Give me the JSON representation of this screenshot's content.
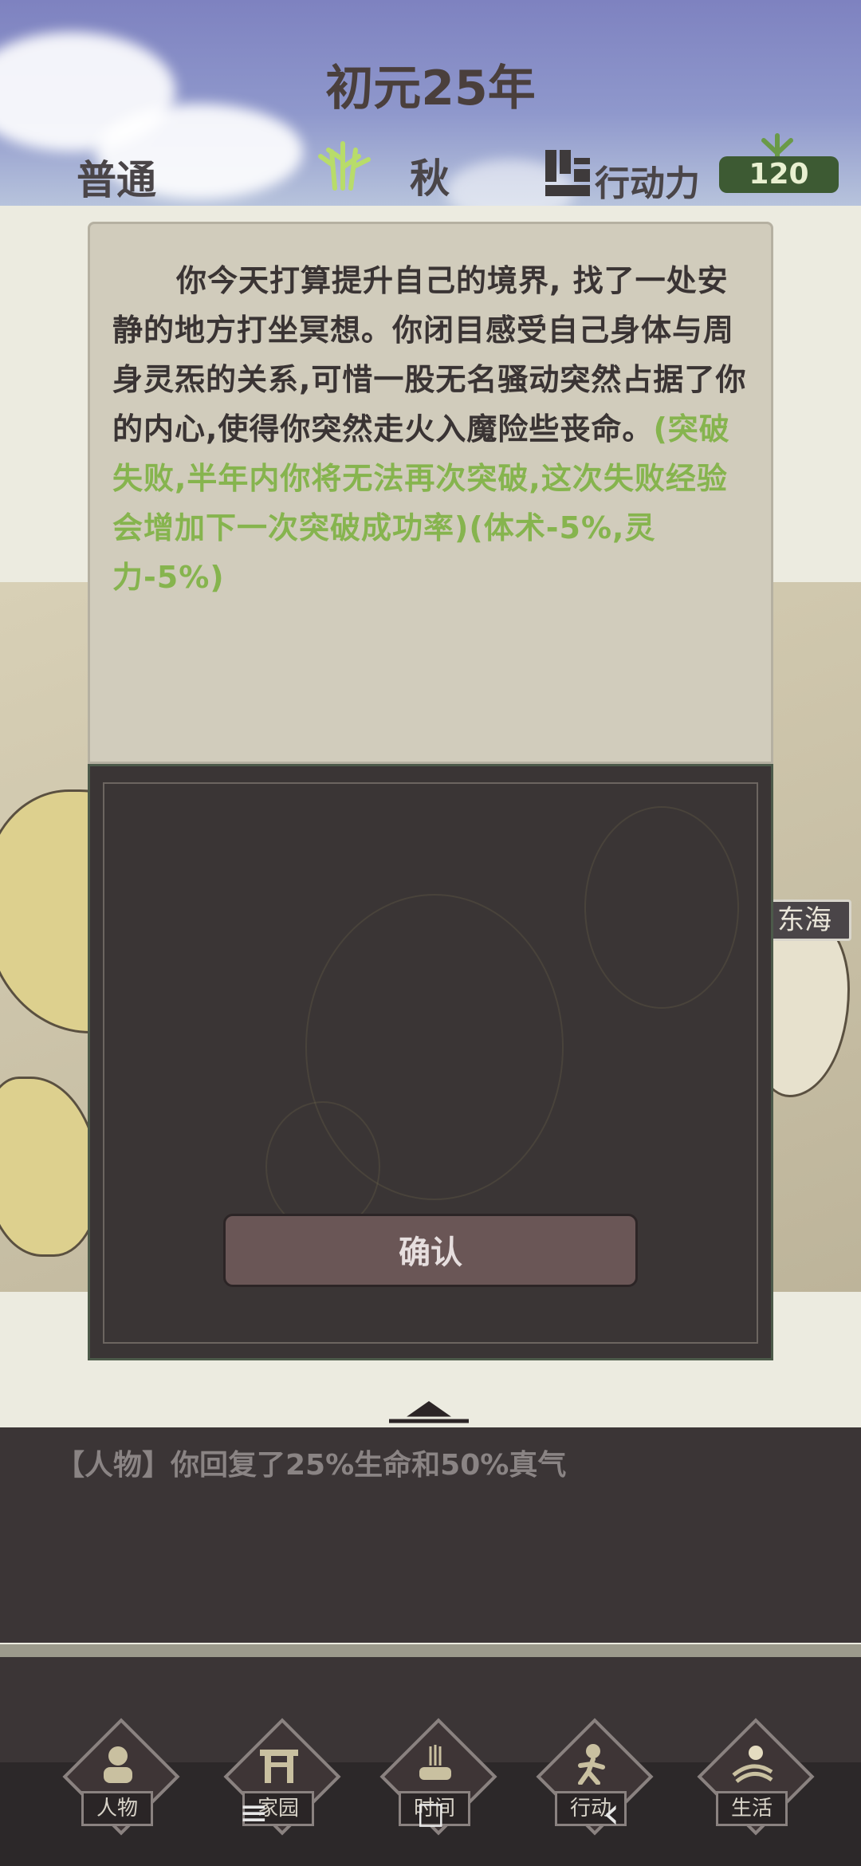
{
  "header": {
    "title": "初元25年",
    "difficulty": "普通",
    "season": "秋",
    "action_points_label": "行动力",
    "action_points_value": "120",
    "season_icon": "bamboo-icon",
    "action_points_icon": "building-icon"
  },
  "map": {
    "sea_label": "东海"
  },
  "dialog": {
    "text_normal": "你今天打算提升自己的境界, 找了一处安静的地方打坐冥想。你闭目感受自己身体与周身灵炁的关系,可惜一股无名骚动突然占据了你的内心,使得你突然走火入魔险些丧命。",
    "text_green": "(突破失败,半年内你将无法再次突破,这次失败经验会增加下一次突破成功率)(体术-5%,灵力-5%)",
    "confirm_label": "确认"
  },
  "log": {
    "line": "【人物】你回复了25%生命和50%真气"
  },
  "tabs": [
    {
      "label": "人物",
      "icon": "person-icon"
    },
    {
      "label": "家园",
      "icon": "gate-icon"
    },
    {
      "label": "时间",
      "icon": "incense-icon"
    },
    {
      "label": "行动",
      "icon": "walking-icon"
    },
    {
      "label": "生活",
      "icon": "landscape-icon"
    }
  ],
  "system_nav": {
    "menu": "≡",
    "home": "◻",
    "back": "‹"
  },
  "colors": {
    "header_sky": "#7e82c0",
    "dialog_parchment": "#d1ccbc",
    "dialog_dark": "#3a3535",
    "highlight_green": "#86b44e",
    "ap_badge": "#3d5a33"
  }
}
